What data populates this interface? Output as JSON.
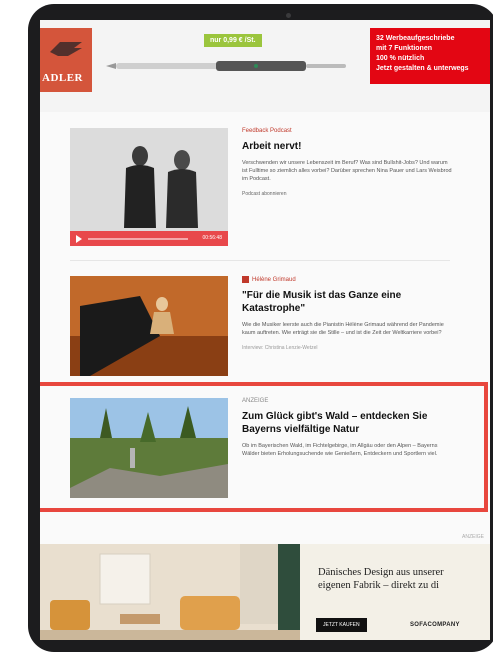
{
  "top_ad": {
    "brand": "ADLER",
    "price": "nur 0,99 € /St.",
    "promo_line1": "32 Werbeaufgeschriebe",
    "promo_line2": "mit 7 Funktionen",
    "promo_line3": "100 % nützlich",
    "promo_line4": "Jetzt gestalten & unterwegs",
    "colors": {
      "brand": "#d4553b",
      "promo": "#e30613",
      "price": "#9bc53d"
    }
  },
  "articles": [
    {
      "kicker": "Feedback Podcast",
      "title": "Arbeit nervt!",
      "description": "Verschwenden wir unsere Lebenszeit im Beruf? Was sind Bullshit-Jobs? Und warum ist Fulltime so ziemlich alles vorbei? Darüber sprechen Nina Pauer und Lars Weisbrod im Podcast.",
      "links": "Podcast abonnieren",
      "player_time": "00:56:48"
    },
    {
      "kicker": "Hélène Grimaud",
      "title": "\"Für die Musik ist das Ganze eine Katastrophe\"",
      "description": "Wie die Musiker leerste auch die Pianistin Hélène Grimaud während der Pandemie kaum auftreten. Wie erträgt sie die Stille – und ist die Zeit der Weltkarriere vorbei?",
      "meta": "Interview: Christina Lenzie-Wetzel"
    },
    {
      "kicker": "ANZEIGE",
      "title": "Zum Glück gibt's Wald – entdecken Sie Bayerns vielfältige Natur",
      "description": "Ob im Bayerischen Wald, im Fichtelgebirge, im Allgäu oder den Alpen – Bayerns Wälder bieten Erholungsuchende wie Genießern, Entdeckern und Sportlern viel."
    }
  ],
  "bottom_ad": {
    "label": "ANZEIGE",
    "copy_line1": "Dänisches Design aus unserer",
    "copy_line2": "eigenen Fabrik – direkt zu di",
    "cta": "JETZT KAUFEN",
    "brand": "SOFACOMPANY"
  }
}
